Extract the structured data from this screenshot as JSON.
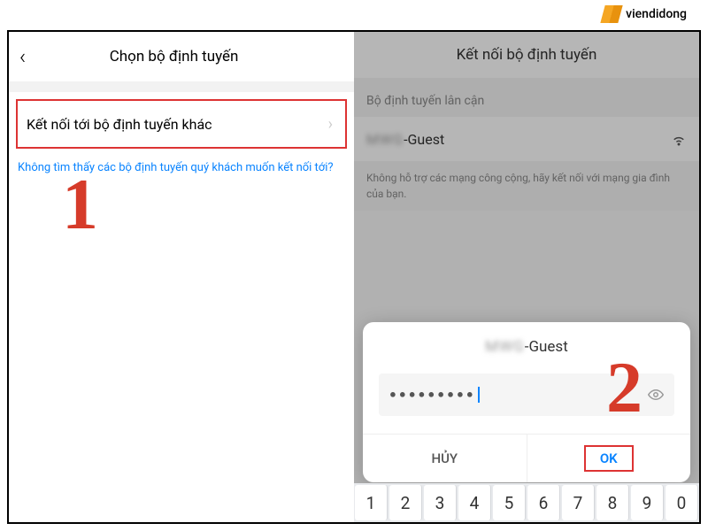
{
  "watermark": {
    "text": "viendidong"
  },
  "annotations": {
    "step1": "1",
    "step2": "2"
  },
  "left_screen": {
    "title": "Chọn bộ định tuyến",
    "connect_other": "Kết nối tới bộ định tuyến khác",
    "help_text": "Không tìm thấy các bộ định tuyến quý khách muốn kết nối tới?"
  },
  "right_screen": {
    "title": "Kết nối bộ định tuyến",
    "nearby_label": "Bộ định tuyến lân cận",
    "wifi_blur": "MWG",
    "wifi_name_suffix": "-Guest",
    "info_text": "Không hỗ trợ các mạng công cộng, hãy kết nối với mạng gia đình của bạn."
  },
  "dialog": {
    "title_blur": "MWG",
    "title_suffix": "-Guest",
    "password_dots": "●●●●●●●●●",
    "cancel": "HỦY",
    "ok": "OK"
  },
  "keyboard": {
    "keys": [
      "1",
      "2",
      "3",
      "4",
      "5",
      "6",
      "7",
      "8",
      "9",
      "0"
    ]
  }
}
